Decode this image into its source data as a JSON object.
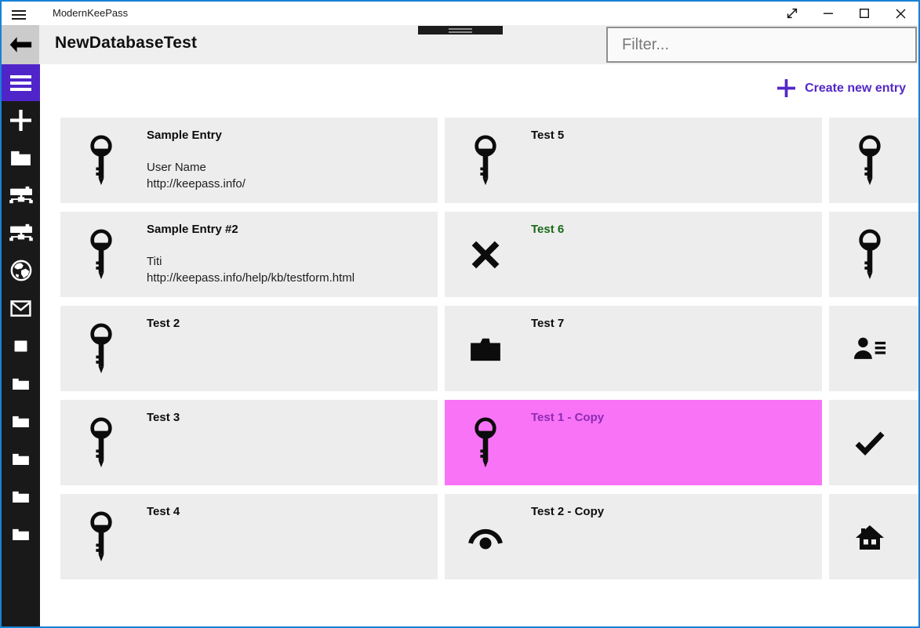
{
  "window": {
    "app_title": "ModernKeePass",
    "controls": [
      {
        "name": "fullscreen"
      },
      {
        "name": "minimize"
      },
      {
        "name": "maximize"
      },
      {
        "name": "close"
      }
    ]
  },
  "header": {
    "title": "NewDatabaseTest",
    "filter_placeholder": "Filter..."
  },
  "toolbar": {
    "create_label": "Create new entry"
  },
  "sidebar": {
    "items": [
      {
        "icon": "menu",
        "active": true
      },
      {
        "icon": "add"
      },
      {
        "icon": "folder"
      },
      {
        "icon": "remote-database"
      },
      {
        "icon": "remote-database"
      },
      {
        "icon": "web"
      },
      {
        "icon": "mail"
      },
      {
        "icon": "item"
      },
      {
        "icon": "group-folder"
      },
      {
        "icon": "group-folder"
      },
      {
        "icon": "group-folder"
      },
      {
        "icon": "group-folder"
      },
      {
        "icon": "group-folder"
      }
    ]
  },
  "grid": {
    "columns": [
      [
        {
          "title": "Sample Entry",
          "icon": "key",
          "details": [
            "User Name",
            "http://keepass.info/"
          ]
        },
        {
          "title": "Sample Entry #2",
          "icon": "key",
          "details": [
            "Titi",
            "http://keepass.info/help/kb/testform.html"
          ]
        },
        {
          "title": "Test 2",
          "icon": "key"
        },
        {
          "title": "Test 3",
          "icon": "key"
        },
        {
          "title": "Test 4",
          "icon": "key"
        }
      ],
      [
        {
          "title": "Test 5",
          "icon": "key"
        },
        {
          "title": "Test 6",
          "icon": "cross",
          "title_color": "#1a691a"
        },
        {
          "title": "Test 7",
          "icon": "folder"
        },
        {
          "title": "Test 1 - Copy",
          "icon": "key",
          "selected": true,
          "title_color": "#8d2bb3"
        },
        {
          "title": "Test 2 - Copy",
          "icon": "eye"
        }
      ],
      [
        {
          "title": "",
          "icon": "key"
        },
        {
          "title": "",
          "icon": "key"
        },
        {
          "title": "",
          "icon": "contact-list"
        },
        {
          "title": "",
          "icon": "check"
        },
        {
          "title": "",
          "icon": "home"
        }
      ]
    ]
  },
  "colors": {
    "border": "#1583d6",
    "accent": "#5328c8",
    "nav_block": "#4f25c9",
    "selection": "#f973f7",
    "green_title": "#1a691a",
    "selected_title": "#8d2bb3",
    "card_bg": "#ededed",
    "header_bg": "#efefef",
    "sidebar_bg": "#191919",
    "back_btn_bg": "#cbcbcb"
  }
}
